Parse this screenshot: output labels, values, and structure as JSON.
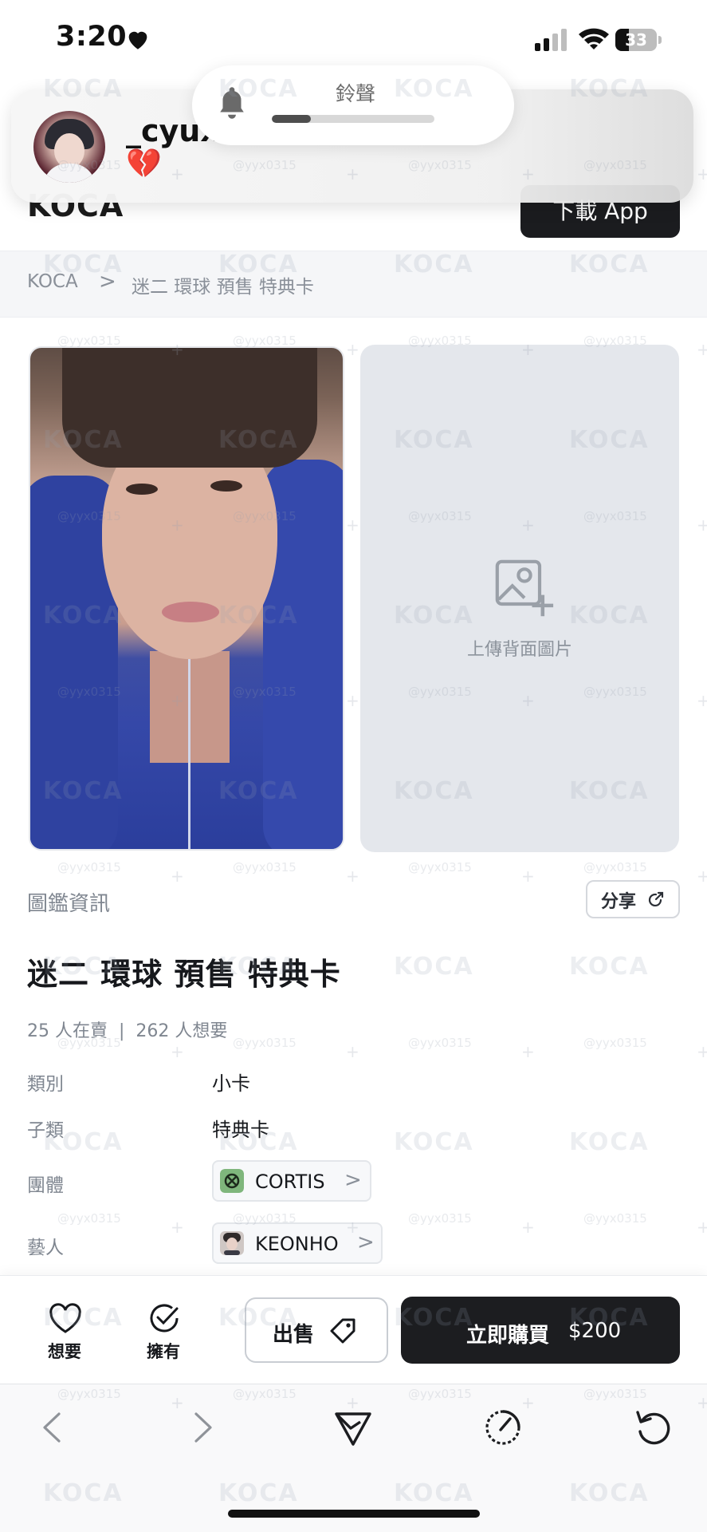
{
  "status_bar": {
    "time": "3:20",
    "battery": "33"
  },
  "notification": {
    "sender": "_cyux",
    "emoji": "💔"
  },
  "ringer": {
    "label": "鈴聲",
    "level": 0.24
  },
  "header": {
    "logo": "KOCA",
    "download_label": "下載 App"
  },
  "breadcrumb": {
    "home": "KOCA",
    "separator": ">",
    "current": "迷二 環球 預售 特典卡"
  },
  "images": {
    "upload_back_label": "上傳背面圖片"
  },
  "info": {
    "section_label": "圖鑑資訊",
    "share_label": "分享",
    "title": "迷二 環球 預售 特典卡",
    "selling": "25 人在賣",
    "stats_divider": "|",
    "wanted": "262 人想要",
    "rows": [
      {
        "label": "類別",
        "value": "小卡"
      },
      {
        "label": "子類",
        "value": "特典卡"
      },
      {
        "label": "團體",
        "value": "CORTIS",
        "chevron": ">"
      },
      {
        "label": "藝人",
        "value": "KEONHO",
        "chevron": ">"
      }
    ]
  },
  "actions": {
    "want_label": "想要",
    "own_label": "擁有",
    "sell_label": "出售",
    "buy_label": "立即購買",
    "buy_price": "$200"
  },
  "watermark": {
    "brand": "KOCA",
    "handle": "@yyx0315"
  },
  "colors": {
    "accent_dark": "#1c1d20",
    "muted_text": "#7f8690",
    "panel_bg": "#e4e7ec"
  }
}
